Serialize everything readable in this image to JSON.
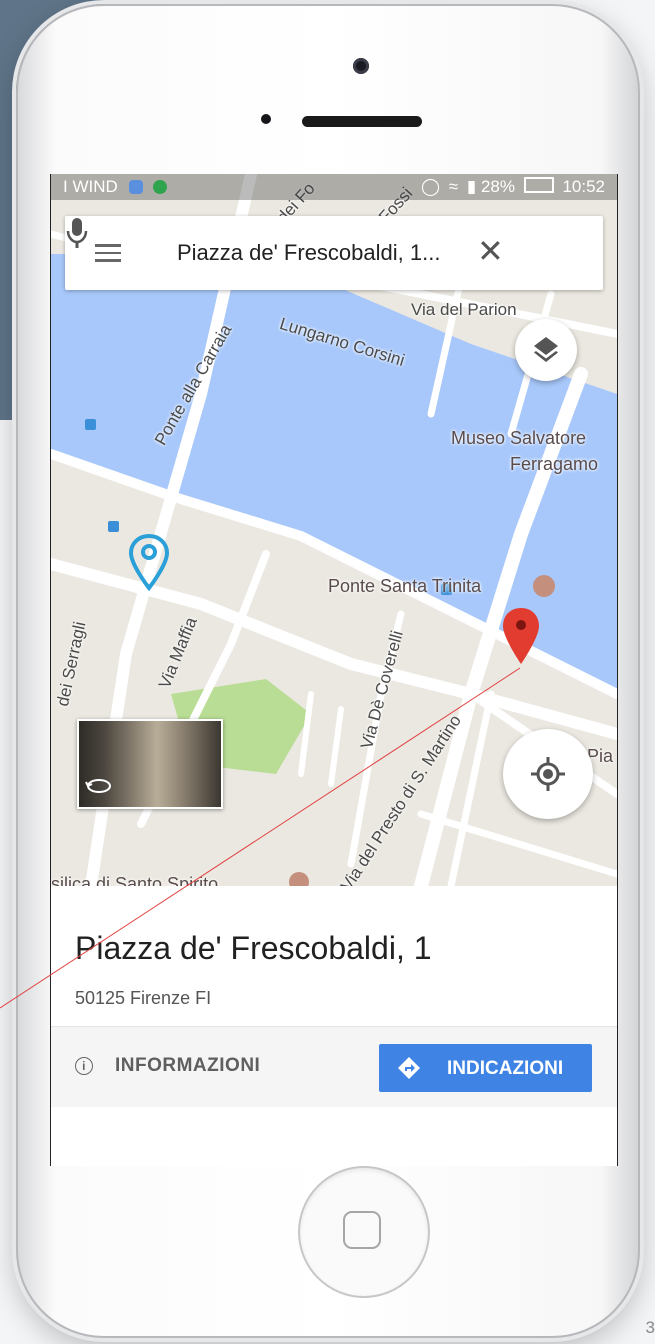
{
  "status_bar": {
    "carrier": "I WIND",
    "battery": "28%",
    "time": "10:52"
  },
  "search": {
    "query": "Piazza de' Frescobaldi, 1...",
    "menu_icon": "menu-icon",
    "clear_icon": "close-icon",
    "mic_icon": "mic-icon"
  },
  "map": {
    "streets": [
      "Via del Parion",
      "Lungarno Corsini",
      "Ponte alla Carraia",
      "Via Maffia",
      "Via Dè Coverelli",
      "Via del Presto di S. Martino",
      "dei Serragli",
      "dei Fo",
      "Fossi"
    ],
    "pois": [
      "Museo Salvatore",
      "Ferragamo",
      "Ponte Santa Trinita",
      "silica di Santo Spirito",
      "Pia"
    ],
    "colors": {
      "water": "#a8c8fb",
      "land": "#ebe8e1",
      "park": "#b9dd95",
      "road": "#ffffff",
      "red_pin": "#e23b30",
      "blue_pin": "#2a9fd8"
    }
  },
  "place": {
    "title": "Piazza de' Frescobaldi, 1",
    "address": "50125 Firenze FI"
  },
  "actions": {
    "info_label": "INFORMAZIONI",
    "directions_label": "INDICAZIONI"
  },
  "page_number": "3"
}
